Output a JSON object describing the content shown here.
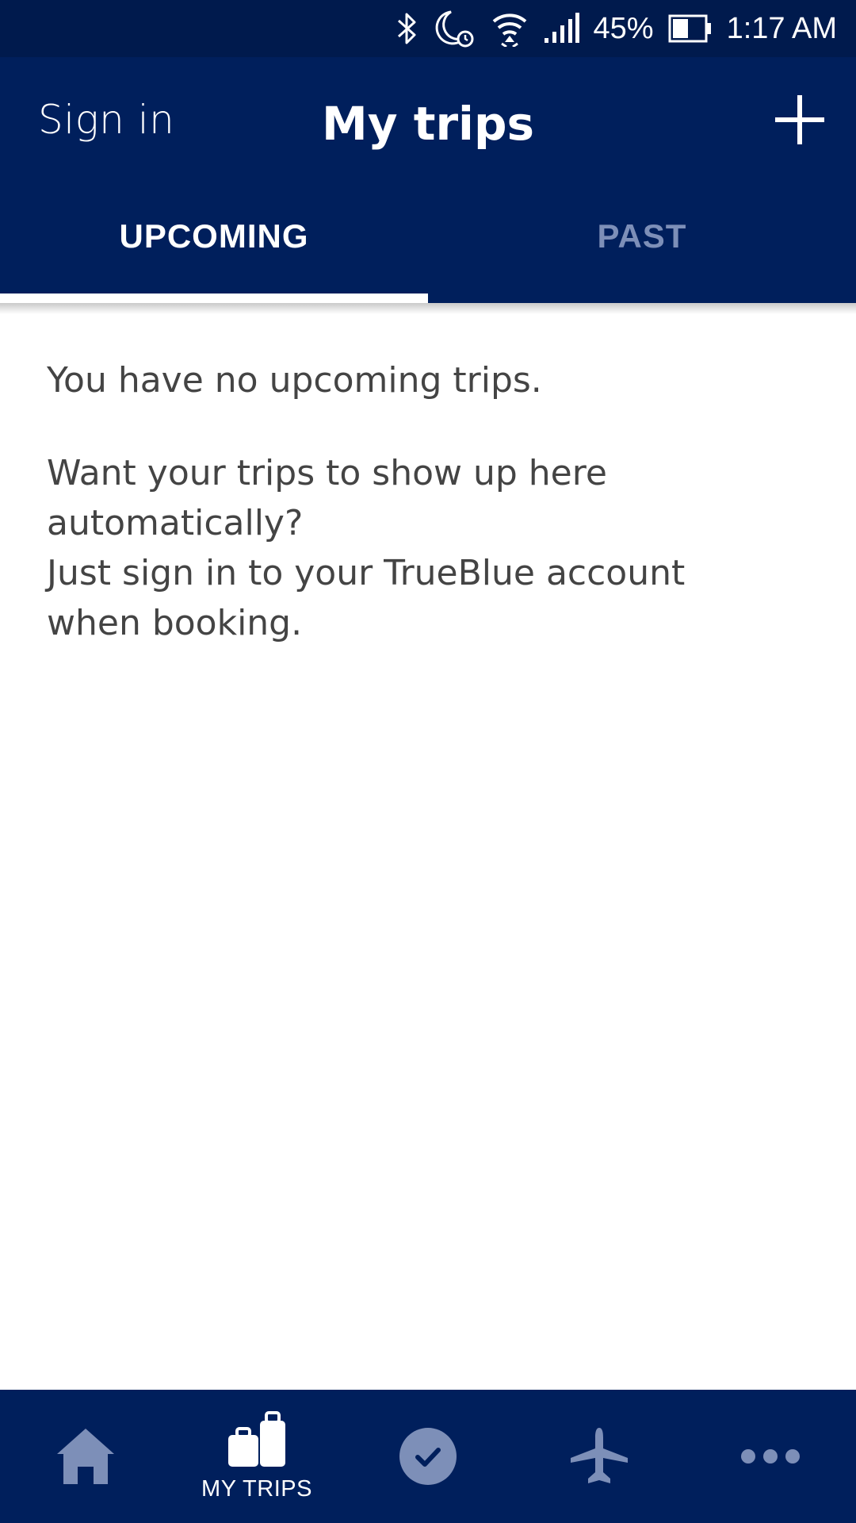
{
  "status_bar": {
    "battery": "45%",
    "time": "1:17 AM",
    "icons": [
      "bluetooth-icon",
      "do-not-disturb-alarm-icon",
      "wifi-icon",
      "signal-icon",
      "battery-icon"
    ]
  },
  "header": {
    "sign_in_label": "Sign in",
    "title": "My trips",
    "add_icon": "plus-icon"
  },
  "tabs": [
    {
      "label": "UPCOMING",
      "active": true
    },
    {
      "label": "PAST",
      "active": false
    }
  ],
  "content": {
    "empty_message": "You have no upcoming trips.",
    "hint_line1": "Want your trips to show up here automatically?",
    "hint_line2": "Just sign in to your TrueBlue account",
    "hint_line3": "when booking."
  },
  "bottom_nav": {
    "items": [
      {
        "icon": "home-icon",
        "label": ""
      },
      {
        "icon": "luggage-icon",
        "label": "MY TRIPS",
        "active": true
      },
      {
        "icon": "check-in-icon",
        "label": ""
      },
      {
        "icon": "airplane-icon",
        "label": ""
      },
      {
        "icon": "more-icon",
        "label": ""
      }
    ]
  },
  "colors": {
    "header_bg": "#001f5c",
    "status_bg": "#001a4d",
    "inactive_nav": "#7d8fb8",
    "body_text": "#444444"
  }
}
